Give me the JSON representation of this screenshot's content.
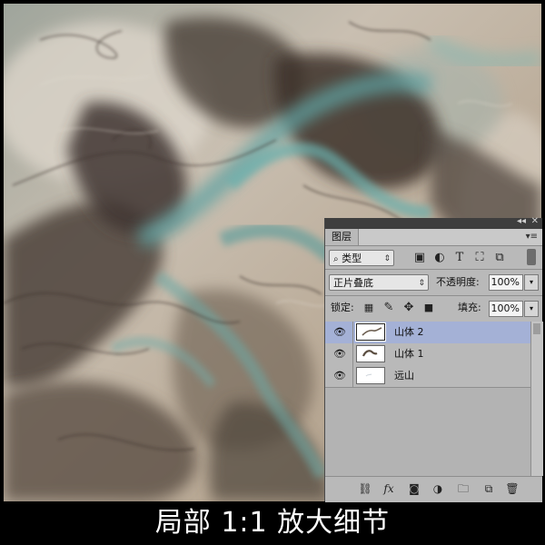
{
  "caption": "局部 1:1 放大细节",
  "panel": {
    "tab_label": "图层",
    "filter": {
      "kind_label": "类型",
      "icons": [
        "image-filter-icon",
        "adjustment-filter-icon",
        "type-filter-icon",
        "shape-filter-icon",
        "smart-object-filter-icon"
      ],
      "type_glyph": "T"
    },
    "blend_mode": "正片叠底",
    "opacity_label": "不透明度:",
    "opacity_value": "100%",
    "lock_label": "锁定:",
    "fill_label": "填充:",
    "fill_value": "100%",
    "layers": [
      {
        "name": "山体 2",
        "selected": true,
        "visible": true
      },
      {
        "name": "山体 1",
        "selected": false,
        "visible": true
      },
      {
        "name": "远山",
        "selected": false,
        "visible": true
      }
    ],
    "footer_icons": [
      "link-layers-icon",
      "fx-icon",
      "add-mask-icon",
      "adjustment-layer-icon",
      "new-group-icon",
      "new-layer-icon",
      "delete-layer-icon"
    ],
    "fx_glyph": "fx"
  },
  "colors": {
    "panel_bg": "#b9b9b9",
    "selected_row": "#a4b1d6",
    "smoke_brown": "#5a4f46",
    "smoke_teal": "#5fa3a3",
    "paper": "#cfc3b3"
  }
}
